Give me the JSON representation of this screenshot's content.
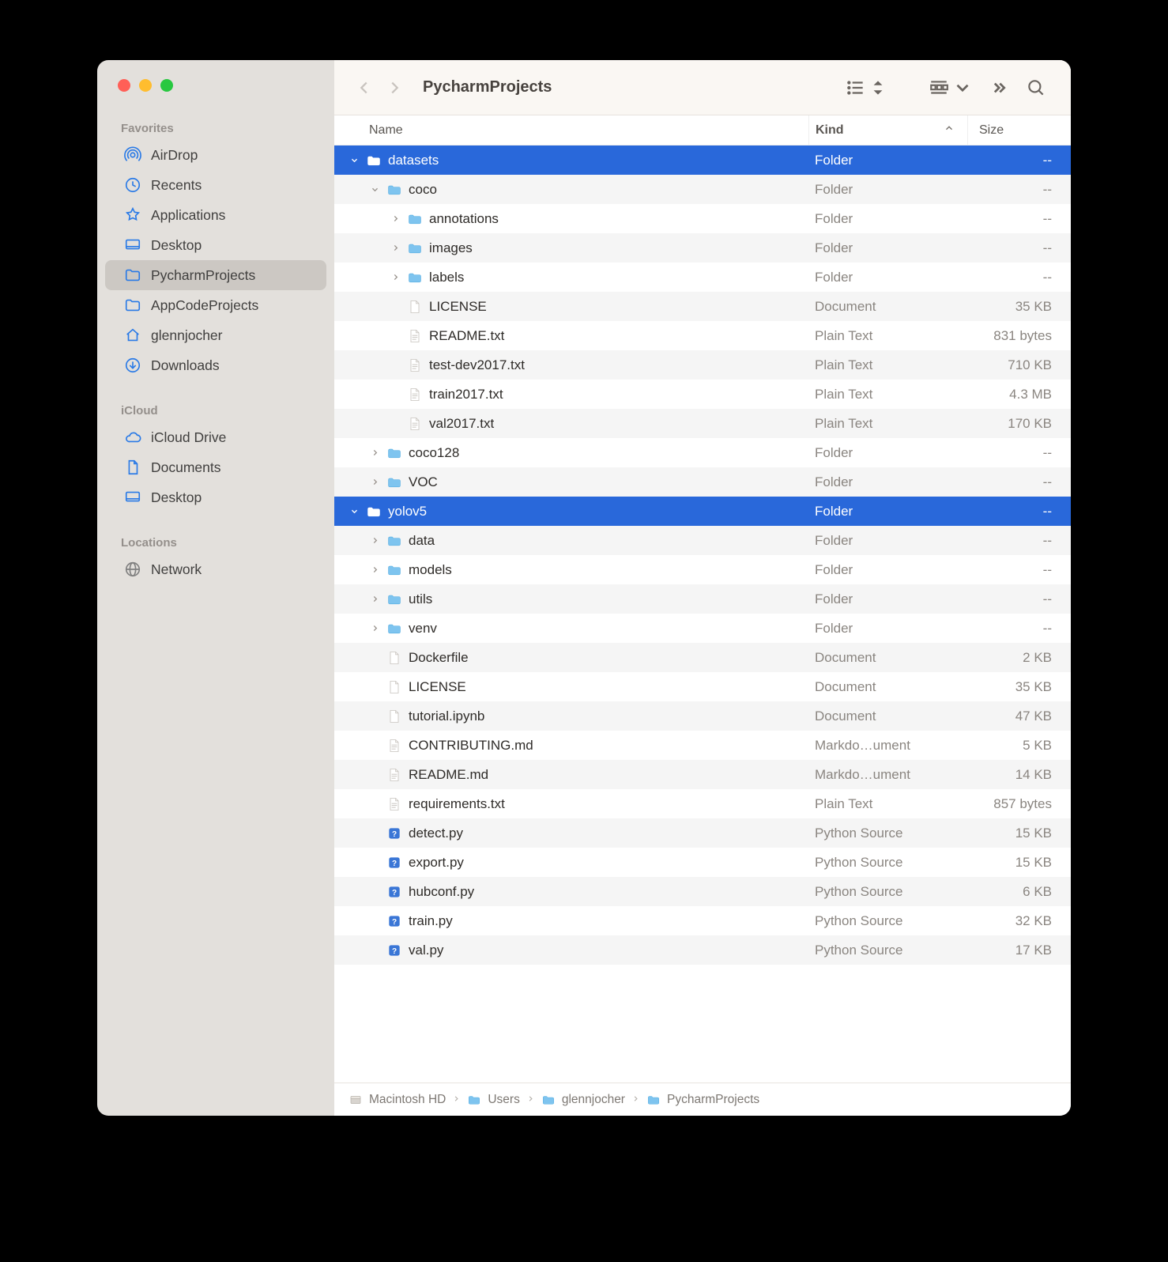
{
  "window": {
    "title": "PycharmProjects"
  },
  "sidebar": {
    "sections": [
      {
        "label": "Favorites",
        "items": [
          {
            "icon": "airdrop",
            "label": "AirDrop"
          },
          {
            "icon": "recents",
            "label": "Recents"
          },
          {
            "icon": "applications",
            "label": "Applications"
          },
          {
            "icon": "desktop",
            "label": "Desktop"
          },
          {
            "icon": "folder",
            "label": "PycharmProjects",
            "active": true
          },
          {
            "icon": "folder",
            "label": "AppCodeProjects"
          },
          {
            "icon": "home",
            "label": "glennjocher"
          },
          {
            "icon": "downloads",
            "label": "Downloads"
          }
        ]
      },
      {
        "label": "iCloud",
        "items": [
          {
            "icon": "icloud",
            "label": "iCloud Drive"
          },
          {
            "icon": "document",
            "label": "Documents"
          },
          {
            "icon": "desktop",
            "label": "Desktop"
          }
        ]
      },
      {
        "label": "Locations",
        "items": [
          {
            "icon": "network",
            "label": "Network",
            "gray": true
          }
        ]
      }
    ]
  },
  "columns": {
    "name": "Name",
    "kind": "Kind",
    "size": "Size"
  },
  "rows": [
    {
      "depth": 0,
      "expand": "down",
      "icon": "folder",
      "name": "datasets",
      "kind": "Folder",
      "size": "--",
      "selected": true
    },
    {
      "depth": 1,
      "expand": "down",
      "icon": "folder",
      "name": "coco",
      "kind": "Folder",
      "size": "--"
    },
    {
      "depth": 2,
      "expand": "right",
      "icon": "folder",
      "name": "annotations",
      "kind": "Folder",
      "size": "--"
    },
    {
      "depth": 2,
      "expand": "right",
      "icon": "folder",
      "name": "images",
      "kind": "Folder",
      "size": "--"
    },
    {
      "depth": 2,
      "expand": "right",
      "icon": "folder",
      "name": "labels",
      "kind": "Folder",
      "size": "--"
    },
    {
      "depth": 2,
      "expand": "none",
      "icon": "blank",
      "name": "LICENSE",
      "kind": "Document",
      "size": "35 KB"
    },
    {
      "depth": 2,
      "expand": "none",
      "icon": "txt",
      "name": "README.txt",
      "kind": "Plain Text",
      "size": "831 bytes"
    },
    {
      "depth": 2,
      "expand": "none",
      "icon": "txt",
      "name": "test-dev2017.txt",
      "kind": "Plain Text",
      "size": "710 KB"
    },
    {
      "depth": 2,
      "expand": "none",
      "icon": "txt",
      "name": "train2017.txt",
      "kind": "Plain Text",
      "size": "4.3 MB"
    },
    {
      "depth": 2,
      "expand": "none",
      "icon": "txt",
      "name": "val2017.txt",
      "kind": "Plain Text",
      "size": "170 KB"
    },
    {
      "depth": 1,
      "expand": "right",
      "icon": "folder",
      "name": "coco128",
      "kind": "Folder",
      "size": "--"
    },
    {
      "depth": 1,
      "expand": "right",
      "icon": "folder",
      "name": "VOC",
      "kind": "Folder",
      "size": "--"
    },
    {
      "depth": 0,
      "expand": "down",
      "icon": "folder",
      "name": "yolov5",
      "kind": "Folder",
      "size": "--",
      "selected": true
    },
    {
      "depth": 1,
      "expand": "right",
      "icon": "folder",
      "name": "data",
      "kind": "Folder",
      "size": "--"
    },
    {
      "depth": 1,
      "expand": "right",
      "icon": "folder",
      "name": "models",
      "kind": "Folder",
      "size": "--"
    },
    {
      "depth": 1,
      "expand": "right",
      "icon": "folder",
      "name": "utils",
      "kind": "Folder",
      "size": "--"
    },
    {
      "depth": 1,
      "expand": "right",
      "icon": "folder",
      "name": "venv",
      "kind": "Folder",
      "size": "--"
    },
    {
      "depth": 1,
      "expand": "none",
      "icon": "blank",
      "name": "Dockerfile",
      "kind": "Document",
      "size": "2 KB"
    },
    {
      "depth": 1,
      "expand": "none",
      "icon": "blank",
      "name": "LICENSE",
      "kind": "Document",
      "size": "35 KB"
    },
    {
      "depth": 1,
      "expand": "none",
      "icon": "blank",
      "name": "tutorial.ipynb",
      "kind": "Document",
      "size": "47 KB"
    },
    {
      "depth": 1,
      "expand": "none",
      "icon": "md",
      "name": "CONTRIBUTING.md",
      "kind": "Markdo…ument",
      "size": "5 KB"
    },
    {
      "depth": 1,
      "expand": "none",
      "icon": "md",
      "name": "README.md",
      "kind": "Markdo…ument",
      "size": "14 KB"
    },
    {
      "depth": 1,
      "expand": "none",
      "icon": "txt",
      "name": "requirements.txt",
      "kind": "Plain Text",
      "size": "857 bytes"
    },
    {
      "depth": 1,
      "expand": "none",
      "icon": "py",
      "name": "detect.py",
      "kind": "Python Source",
      "size": "15 KB"
    },
    {
      "depth": 1,
      "expand": "none",
      "icon": "py",
      "name": "export.py",
      "kind": "Python Source",
      "size": "15 KB"
    },
    {
      "depth": 1,
      "expand": "none",
      "icon": "py",
      "name": "hubconf.py",
      "kind": "Python Source",
      "size": "6 KB"
    },
    {
      "depth": 1,
      "expand": "none",
      "icon": "py",
      "name": "train.py",
      "kind": "Python Source",
      "size": "32 KB"
    },
    {
      "depth": 1,
      "expand": "none",
      "icon": "py",
      "name": "val.py",
      "kind": "Python Source",
      "size": "17 KB"
    }
  ],
  "pathbar": [
    {
      "icon": "disk",
      "label": "Macintosh HD"
    },
    {
      "icon": "folder",
      "label": "Users"
    },
    {
      "icon": "folder",
      "label": "glennjocher"
    },
    {
      "icon": "folder",
      "label": "PycharmProjects"
    }
  ]
}
